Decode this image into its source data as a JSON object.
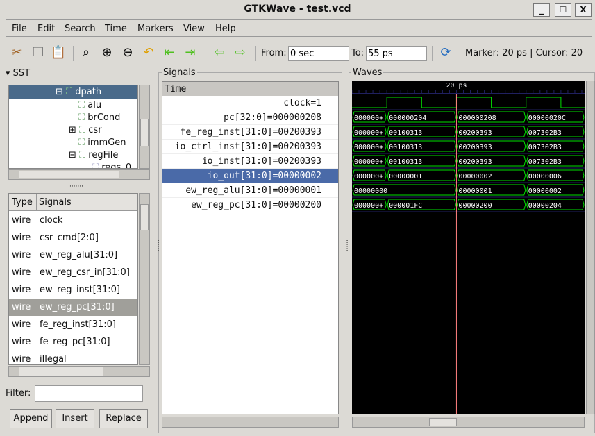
{
  "window": {
    "title": "GTKWave - test.vcd",
    "minimize": "_",
    "maximize": "☐",
    "close": "X"
  },
  "menu": [
    "File",
    "Edit",
    "Search",
    "Time",
    "Markers",
    "View",
    "Help"
  ],
  "toolbar": {
    "from_label": "From:",
    "from_value": "0 sec",
    "to_label": "To:",
    "to_value": "55 ps",
    "marker_label": "Marker: 20 ps",
    "sep": "|",
    "cursor_label": "Cursor: 20",
    "icons": [
      "cut-icon",
      "copy-icon",
      "paste-icon",
      "zoom-fit-icon",
      "zoom-in-icon",
      "zoom-out-icon",
      "undo-zoom-icon",
      "go-start-icon",
      "go-end-icon",
      "back-icon",
      "forward-icon",
      "reload-icon"
    ]
  },
  "sst": {
    "title": "SST",
    "tree": [
      {
        "label": "dpath",
        "selected": true
      },
      {
        "label": "alu"
      },
      {
        "label": "brCond"
      },
      {
        "label": "csr"
      },
      {
        "label": "immGen"
      },
      {
        "label": "regFile"
      },
      {
        "label": "regs_0"
      }
    ],
    "columns": {
      "type": "Type",
      "signals": "Signals"
    },
    "signals": [
      {
        "type": "wire",
        "name": "clock"
      },
      {
        "type": "wire",
        "name": "csr_cmd[2:0]"
      },
      {
        "type": "wire",
        "name": "ew_reg_alu[31:0]"
      },
      {
        "type": "wire",
        "name": "ew_reg_csr_in[31:0]"
      },
      {
        "type": "wire",
        "name": "ew_reg_inst[31:0]"
      },
      {
        "type": "wire",
        "name": "ew_reg_pc[31:0]",
        "selected": true
      },
      {
        "type": "wire",
        "name": "fe_reg_inst[31:0]"
      },
      {
        "type": "wire",
        "name": "fe_reg_pc[31:0]"
      },
      {
        "type": "wire",
        "name": "illegal"
      }
    ],
    "filter_label": "Filter:",
    "filter_value": "",
    "append": "Append",
    "insert": "Insert",
    "replace": "Replace"
  },
  "signals_pane": {
    "title": "Signals",
    "header": "Time",
    "rows": [
      {
        "label": "clock=1"
      },
      {
        "label": "pc[32:0]=000000208"
      },
      {
        "label": "fe_reg_inst[31:0]=00200393"
      },
      {
        "label": "io_ctrl_inst[31:0]=00200393"
      },
      {
        "label": "io_inst[31:0]=00200393"
      },
      {
        "label": "io_out[31:0]=00000002",
        "selected": true
      },
      {
        "label": "ew_reg_alu[31:0]=00000001"
      },
      {
        "label": "ew_reg_pc[31:0]=00000200"
      }
    ]
  },
  "waves": {
    "title": "Waves",
    "marker_label": "20 ps",
    "marker_time": 20,
    "view_start": 5,
    "view_end": 38.4,
    "colors": {
      "bg": "#000000",
      "wave": "#00e000",
      "marker": "#ff8080",
      "ruler": "#202060",
      "text": "#ffffff"
    },
    "clock": [
      [
        5,
        0
      ],
      [
        10,
        1
      ],
      [
        15,
        0
      ],
      [
        20,
        1
      ],
      [
        25,
        0
      ],
      [
        30,
        1
      ],
      [
        35,
        0
      ]
    ],
    "vectors": [
      [
        [
          "000000+",
          5,
          10
        ],
        [
          "000000204",
          10,
          20
        ],
        [
          "000000208",
          20,
          30
        ],
        [
          "00000020C",
          30,
          40
        ]
      ],
      [
        [
          "000000+",
          5,
          10
        ],
        [
          "00100313",
          10,
          20
        ],
        [
          "00200393",
          20,
          30
        ],
        [
          "007302B3",
          30,
          40
        ]
      ],
      [
        [
          "000000+",
          5,
          10
        ],
        [
          "00100313",
          10,
          20
        ],
        [
          "00200393",
          20,
          30
        ],
        [
          "007302B3",
          30,
          40
        ]
      ],
      [
        [
          "000000+",
          5,
          10
        ],
        [
          "00100313",
          10,
          20
        ],
        [
          "00200393",
          20,
          30
        ],
        [
          "007302B3",
          30,
          40
        ]
      ],
      [
        [
          "000000+",
          5,
          10
        ],
        [
          "00000001",
          10,
          20
        ],
        [
          "00000002",
          20,
          30
        ],
        [
          "00000006",
          30,
          40
        ]
      ],
      [
        [
          "00000000",
          5,
          20
        ],
        [
          "00000001",
          20,
          30
        ],
        [
          "00000002",
          30,
          40
        ]
      ],
      [
        [
          "000000+",
          5,
          10
        ],
        [
          "000001FC",
          10,
          20
        ],
        [
          "00000200",
          20,
          30
        ],
        [
          "00000204",
          30,
          40
        ]
      ]
    ]
  }
}
